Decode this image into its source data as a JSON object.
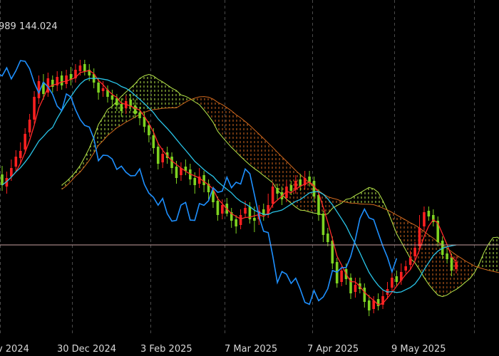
{
  "header": {
    "price_text": "989 144.024"
  },
  "chart_data": {
    "type": "candlestick",
    "indicator": "Ichimoku Kinko Hyo",
    "x_tick_labels": [
      "ov 2024",
      "30 Dec 2024",
      "3 Feb 2025",
      "7 Mar 2025",
      "7 Apr 2025",
      "9 May 2025"
    ],
    "grid": "vertical dashed",
    "colors": {
      "background": "#000000",
      "bull_candle": "#7ed321",
      "bear_candle": "#ff2020",
      "tenkan_sen": "#ff2a2a",
      "kijun_sen": "#29c4e8",
      "chikou_span": "#1e90ff",
      "senkou_span_a": "#b7e84a",
      "senkou_span_b": "#d2691e",
      "kumo_bull_hatch": "#b7e84a",
      "kumo_bear_hatch": "#d2691e",
      "price_line": "#c9a0a0"
    },
    "candles": [
      [
        205,
        220,
        193,
        228
      ],
      [
        222,
        210,
        201,
        232
      ],
      [
        208,
        196,
        184,
        214
      ],
      [
        194,
        180,
        171,
        202
      ],
      [
        182,
        172,
        160,
        190
      ],
      [
        170,
        148,
        140,
        176
      ],
      [
        146,
        128,
        120,
        152
      ],
      [
        128,
        96,
        88,
        134
      ],
      [
        98,
        74,
        66,
        106
      ],
      [
        76,
        92,
        64,
        100
      ],
      [
        90,
        70,
        62,
        96
      ],
      [
        72,
        82,
        66,
        90
      ],
      [
        80,
        68,
        60,
        88
      ],
      [
        66,
        80,
        60,
        86
      ],
      [
        78,
        66,
        58,
        84
      ],
      [
        64,
        72,
        54,
        80
      ],
      [
        70,
        58,
        50,
        76
      ],
      [
        60,
        52,
        44,
        66
      ],
      [
        50,
        60,
        44,
        66
      ],
      [
        58,
        66,
        50,
        74
      ],
      [
        64,
        76,
        56,
        84
      ],
      [
        76,
        90,
        70,
        100
      ],
      [
        88,
        84,
        74,
        96
      ],
      [
        86,
        96,
        80,
        104
      ],
      [
        94,
        100,
        86,
        110
      ],
      [
        98,
        108,
        92,
        116
      ],
      [
        106,
        116,
        98,
        124
      ],
      [
        112,
        102,
        94,
        120
      ],
      [
        100,
        110,
        92,
        116
      ],
      [
        108,
        120,
        100,
        126
      ],
      [
        118,
        126,
        110,
        136
      ],
      [
        124,
        138,
        118,
        146
      ],
      [
        136,
        150,
        130,
        160
      ],
      [
        150,
        168,
        140,
        176
      ],
      [
        166,
        190,
        160,
        198
      ],
      [
        188,
        176,
        168,
        196
      ],
      [
        174,
        182,
        166,
        190
      ],
      [
        180,
        196,
        174,
        204
      ],
      [
        194,
        210,
        186,
        218
      ],
      [
        206,
        196,
        188,
        214
      ],
      [
        194,
        200,
        184,
        206
      ],
      [
        198,
        212,
        190,
        220
      ],
      [
        210,
        220,
        202,
        232
      ],
      [
        218,
        208,
        196,
        224
      ],
      [
        206,
        220,
        200,
        230
      ],
      [
        218,
        230,
        212,
        240
      ],
      [
        228,
        244,
        222,
        252
      ],
      [
        242,
        262,
        236,
        270
      ],
      [
        260,
        248,
        240,
        268
      ],
      [
        246,
        260,
        238,
        264
      ],
      [
        258,
        270,
        252,
        280
      ],
      [
        268,
        278,
        262,
        288
      ],
      [
        276,
        262,
        254,
        282
      ],
      [
        260,
        252,
        242,
        266
      ],
      [
        250,
        268,
        244,
        274
      ],
      [
        266,
        270,
        250,
        286
      ],
      [
        268,
        256,
        248,
        276
      ],
      [
        254,
        262,
        246,
        270
      ],
      [
        260,
        248,
        232,
        266
      ],
      [
        246,
        222,
        216,
        252
      ],
      [
        224,
        232,
        218,
        240
      ],
      [
        230,
        240,
        222,
        248
      ],
      [
        238,
        222,
        214,
        244
      ],
      [
        220,
        228,
        214,
        234
      ],
      [
        226,
        214,
        206,
        232
      ],
      [
        212,
        222,
        204,
        228
      ],
      [
        220,
        210,
        200,
        226
      ],
      [
        208,
        216,
        200,
        222
      ],
      [
        214,
        236,
        208,
        244
      ],
      [
        234,
        262,
        226,
        270
      ],
      [
        260,
        290,
        256,
        300
      ],
      [
        288,
        300,
        280,
        306
      ],
      [
        298,
        330,
        292,
        338
      ],
      [
        328,
        358,
        322,
        364
      ],
      [
        356,
        340,
        334,
        362
      ],
      [
        338,
        352,
        330,
        360
      ],
      [
        350,
        372,
        344,
        380
      ],
      [
        370,
        360,
        350,
        378
      ],
      [
        358,
        366,
        350,
        372
      ],
      [
        364,
        384,
        358,
        392
      ],
      [
        382,
        396,
        374,
        404
      ],
      [
        394,
        382,
        376,
        400
      ],
      [
        380,
        390,
        372,
        396
      ],
      [
        388,
        376,
        368,
        394
      ],
      [
        374,
        366,
        356,
        380
      ],
      [
        364,
        350,
        342,
        370
      ],
      [
        348,
        356,
        340,
        362
      ],
      [
        354,
        342,
        330,
        360
      ],
      [
        340,
        334,
        326,
        344
      ],
      [
        332,
        322,
        312,
        338
      ],
      [
        320,
        308,
        300,
        326
      ],
      [
        306,
        280,
        262,
        312
      ],
      [
        278,
        258,
        250,
        284
      ],
      [
        256,
        264,
        250,
        270
      ],
      [
        262,
        272,
        254,
        278
      ],
      [
        270,
        300,
        264,
        306
      ],
      [
        298,
        318,
        292,
        324
      ],
      [
        316,
        324,
        308,
        330
      ],
      [
        322,
        340,
        316,
        348
      ],
      [
        338,
        328,
        320,
        344
      ]
    ]
  }
}
